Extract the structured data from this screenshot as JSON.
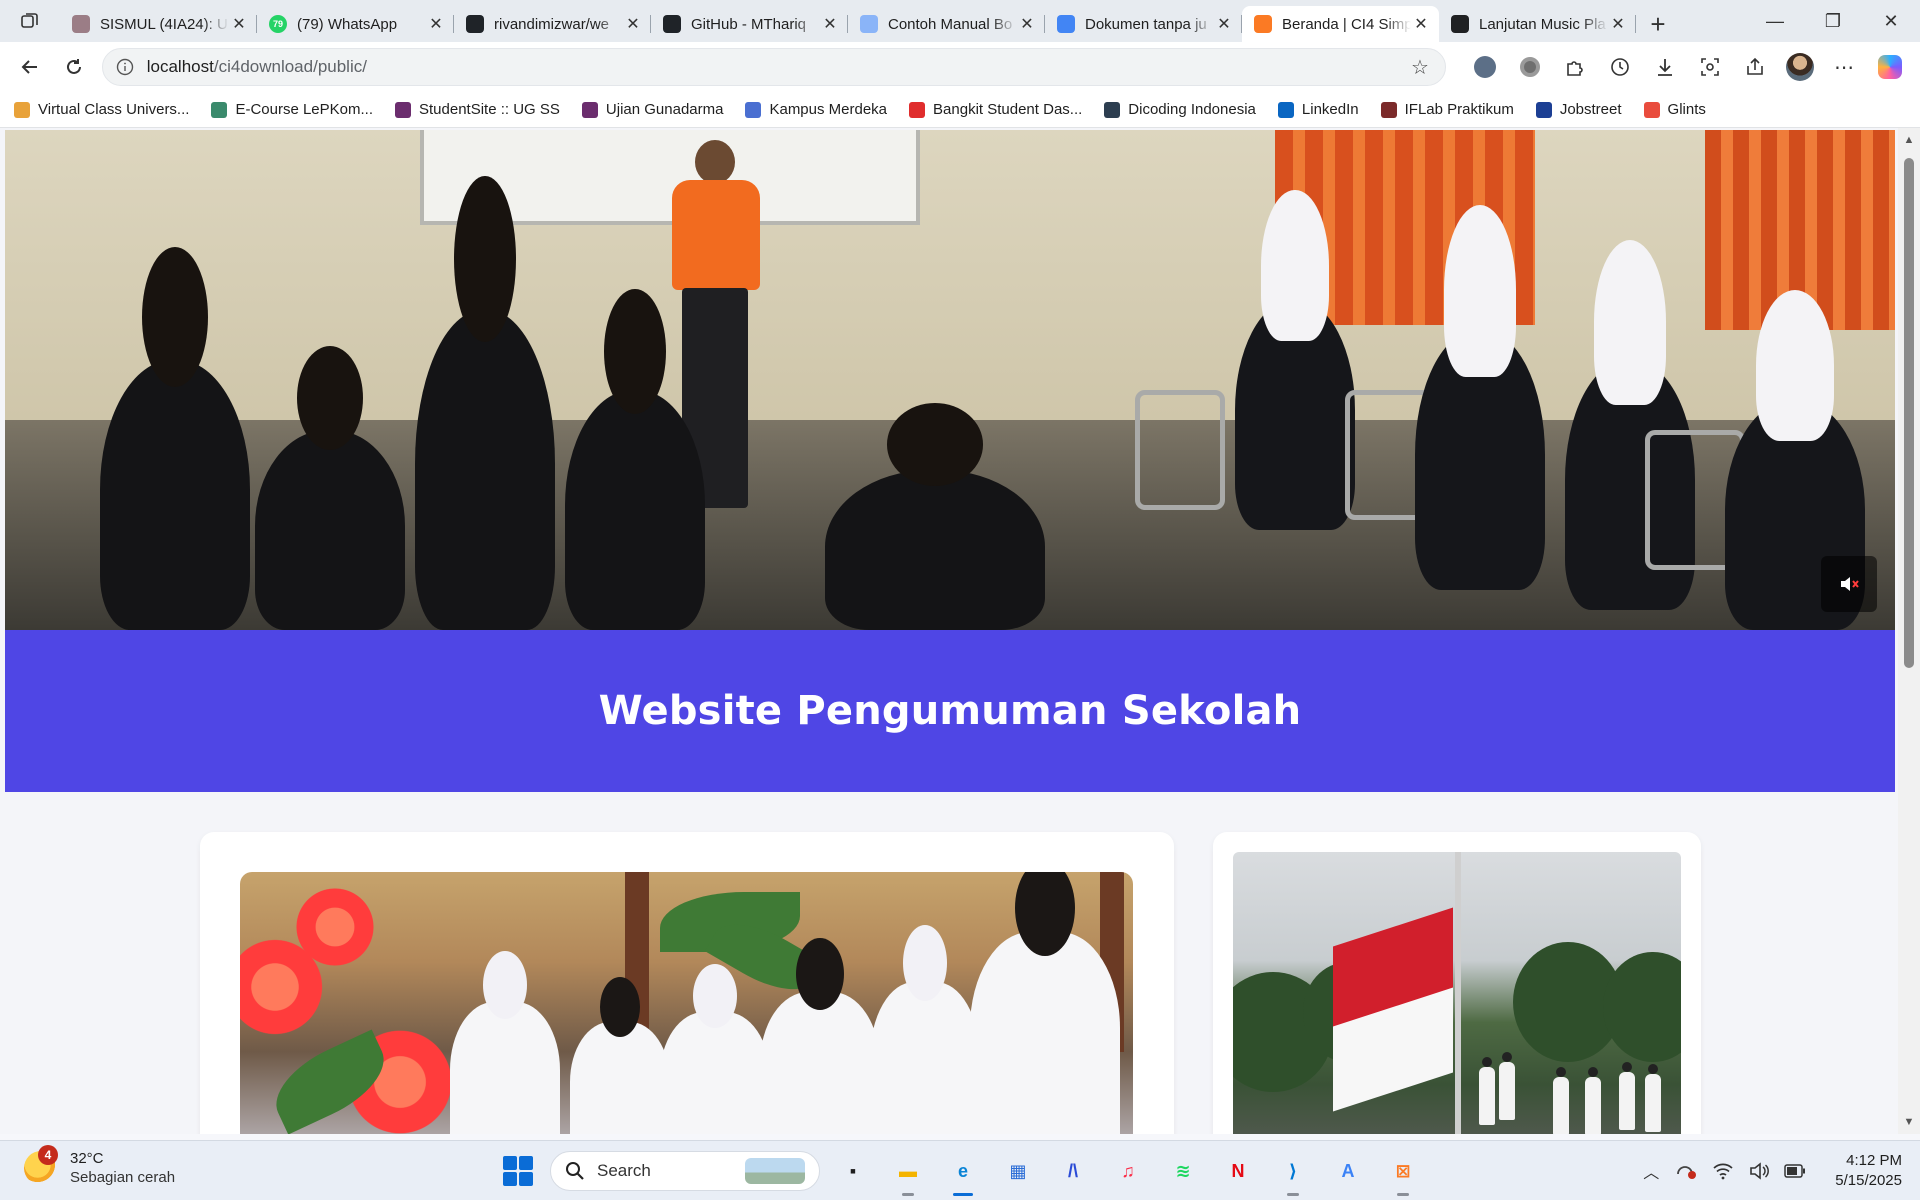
{
  "browser": {
    "tabs": [
      {
        "title": "SISMUL (4IA24): U",
        "icon": "sismul-favicon",
        "color": "#9b7d86",
        "active": false
      },
      {
        "title": "(79) WhatsApp",
        "icon": "whatsapp-favicon",
        "color": "#25d366",
        "badge": "79",
        "active": false
      },
      {
        "title": "rivandimizwar/we",
        "icon": "github-favicon",
        "color": "#1f2328",
        "active": false
      },
      {
        "title": "GitHub - MThariq",
        "icon": "github-favicon",
        "color": "#1f2328",
        "active": false
      },
      {
        "title": "Contoh Manual Bo",
        "icon": "docs-favicon",
        "color": "#8ab4f8",
        "active": false
      },
      {
        "title": "Dokumen tanpa ju",
        "icon": "docs-favicon",
        "color": "#4285f4",
        "active": false
      },
      {
        "title": "Beranda | CI4 Simp",
        "icon": "xampp-favicon",
        "color": "#fb7a24",
        "active": true
      },
      {
        "title": "Lanjutan Music Pla",
        "icon": "chatgpt-favicon",
        "color": "#202123",
        "active": false
      }
    ],
    "address": {
      "host": "localhost",
      "path": "/ci4download/public/"
    },
    "bookmarks": [
      {
        "label": "Virtual Class Univers...",
        "icon": "vclass-icon",
        "color": "#e8a23a"
      },
      {
        "label": "E-Course LePKom...",
        "icon": "ecourse-icon",
        "color": "#3a8a6c"
      },
      {
        "label": "StudentSite :: UG SS",
        "icon": "ug-icon",
        "color": "#6b2d6e"
      },
      {
        "label": "Ujian Gunadarma",
        "icon": "ug-icon",
        "color": "#6b2d6e"
      },
      {
        "label": "Kampus Merdeka",
        "icon": "kampus-merdeka-icon",
        "color": "#4a6fd1"
      },
      {
        "label": "Bangkit Student Das...",
        "icon": "bangkit-icon",
        "color": "#e02d2d"
      },
      {
        "label": "Dicoding Indonesia",
        "icon": "dicoding-icon",
        "color": "#2d3e50"
      },
      {
        "label": "LinkedIn",
        "icon": "linkedin-icon",
        "color": "#0a66c2"
      },
      {
        "label": "IFLab Praktikum",
        "icon": "iflab-icon",
        "color": "#7b2a2a"
      },
      {
        "label": "Jobstreet",
        "icon": "jobstreet-icon",
        "color": "#1c3f94"
      },
      {
        "label": "Glints",
        "icon": "glints-icon",
        "color": "#e94c3d"
      }
    ]
  },
  "page": {
    "banner_title": "Website Pengumuman Sekolah",
    "brand_color": "#4f46e5"
  },
  "taskbar": {
    "weather": {
      "temp": "32°C",
      "condition": "Sebagian cerah",
      "badge": "4"
    },
    "search_label": "Search",
    "apps": [
      {
        "name": "task-view-icon",
        "glyph": "▪",
        "color": "#1f1f1f",
        "running": false
      },
      {
        "name": "file-explorer-icon",
        "glyph": "▬",
        "color": "#f4b400",
        "running": true
      },
      {
        "name": "edge-icon",
        "glyph": "e",
        "color": "#0a84d6",
        "running": true,
        "focused": true
      },
      {
        "name": "store-icon",
        "glyph": "▦",
        "color": "#2a6cd6",
        "running": false
      },
      {
        "name": "ai-app-icon",
        "glyph": "/\\",
        "color": "#2a4bd6",
        "running": false
      },
      {
        "name": "music-icon",
        "glyph": "♫",
        "color": "#fa2d48",
        "running": false
      },
      {
        "name": "spotify-icon",
        "glyph": "≋",
        "color": "#1ed760",
        "running": false
      },
      {
        "name": "netflix-icon",
        "glyph": "N",
        "color": "#e50914",
        "running": false
      },
      {
        "name": "vscode-icon",
        "glyph": "⟩",
        "color": "#0078d4",
        "running": true
      },
      {
        "name": "app-a-icon",
        "glyph": "A",
        "color": "#3b82f6",
        "running": false
      },
      {
        "name": "xampp-icon",
        "glyph": "⊠",
        "color": "#fb7a24",
        "running": true
      }
    ],
    "clock": {
      "time": "4:12 PM",
      "date": "5/15/2025"
    }
  }
}
